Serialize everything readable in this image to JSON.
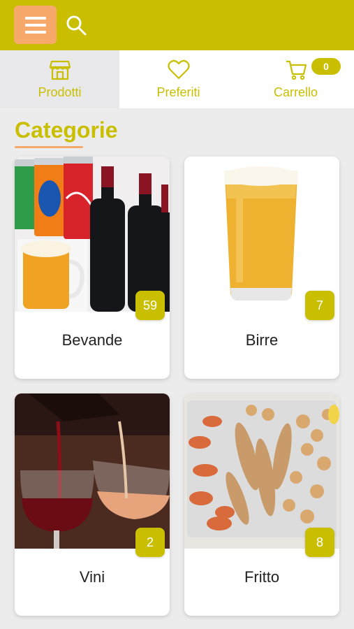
{
  "header": {
    "menu_icon": "hamburger-icon",
    "search_icon": "search-icon",
    "colors": {
      "bar": "#c9bf00",
      "menu_button": "#f6a96b"
    }
  },
  "tabs": [
    {
      "label": "Prodotti",
      "icon": "store-icon",
      "active": true
    },
    {
      "label": "Preferiti",
      "icon": "heart-icon",
      "active": false
    },
    {
      "label": "Carrello",
      "icon": "cart-icon",
      "active": false
    }
  ],
  "cart": {
    "count": "0"
  },
  "section": {
    "title": "Categorie"
  },
  "categories": [
    {
      "name": "Bevande",
      "count": "59"
    },
    {
      "name": "Birre",
      "count": "7"
    },
    {
      "name": "Vini",
      "count": "2"
    },
    {
      "name": "Fritto",
      "count": "8"
    }
  ]
}
